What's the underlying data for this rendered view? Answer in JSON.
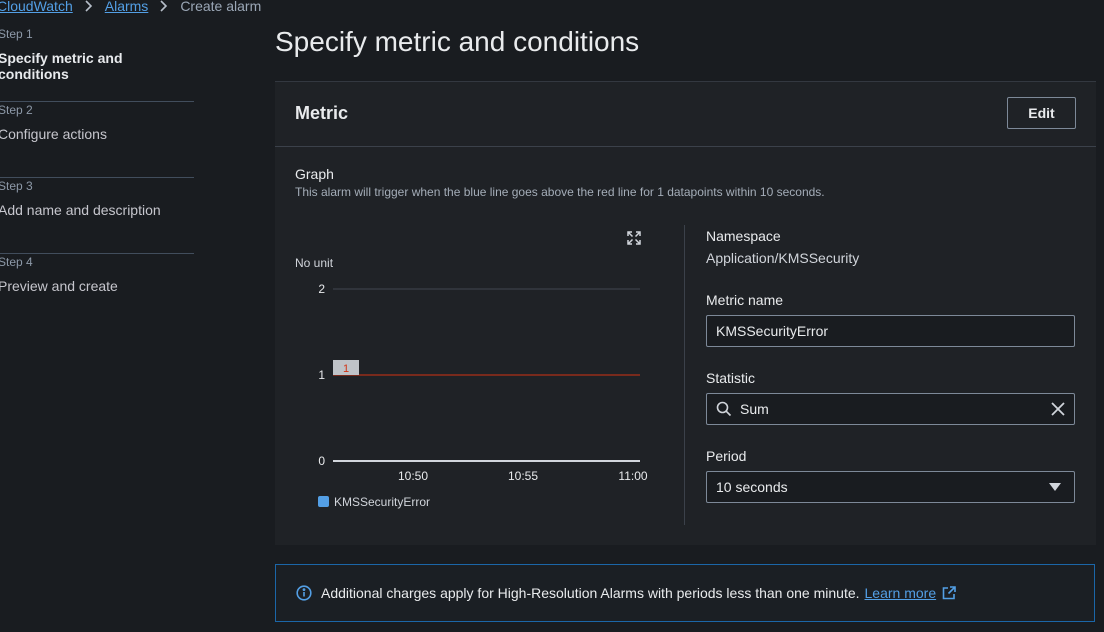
{
  "breadcrumb": {
    "items": [
      "CloudWatch",
      "Alarms"
    ],
    "current": "Create alarm"
  },
  "steps": [
    {
      "label": "Step 1",
      "title": "Specify metric and conditions",
      "active": true
    },
    {
      "label": "Step 2",
      "title": "Configure actions",
      "active": false
    },
    {
      "label": "Step 3",
      "title": "Add name and description",
      "active": false
    },
    {
      "label": "Step 4",
      "title": "Preview and create",
      "active": false
    }
  ],
  "page_title": "Specify metric and conditions",
  "metric_panel": {
    "title": "Metric",
    "edit_label": "Edit",
    "graph_title": "Graph",
    "graph_desc": "This alarm will trigger when the blue line goes above the red line for 1 datapoints within 10 seconds.",
    "no_unit": "No unit",
    "namespace_label": "Namespace",
    "namespace_value": "Application/KMSSecurity",
    "metric_name_label": "Metric name",
    "metric_name_value": "KMSSecurityError",
    "statistic_label": "Statistic",
    "statistic_value": "Sum",
    "period_label": "Period",
    "period_value": "10 seconds"
  },
  "chart_data": {
    "type": "line",
    "ylabel": "No unit",
    "ylim": [
      0,
      2
    ],
    "yticks": [
      "0",
      "1",
      "2"
    ],
    "xticks": [
      "10:50",
      "10:55",
      "11:00"
    ],
    "threshold": {
      "value": 1,
      "label": "1",
      "color": "#d13212"
    },
    "series": [
      {
        "name": "KMSSecurityError",
        "color": "#539fe5",
        "values": []
      }
    ],
    "grid": true
  },
  "alert": {
    "text": "Additional charges apply for High-Resolution Alarms with periods less than one minute.",
    "link": "Learn more"
  },
  "colors": {
    "link": "#539fe5",
    "threshold": "#d13212",
    "series": "#539fe5"
  }
}
